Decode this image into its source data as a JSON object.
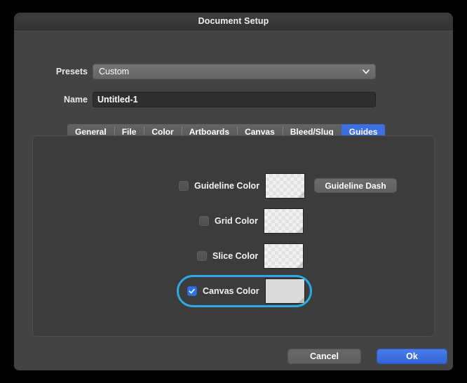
{
  "window": {
    "title": "Document Setup"
  },
  "form": {
    "presets": {
      "label": "Presets",
      "value": "Custom",
      "chevron_icon": "chevron-down-icon"
    },
    "name": {
      "label": "Name",
      "value": "Untitled-1",
      "placeholder": "Untitled-1"
    }
  },
  "tabs": [
    {
      "label": "General",
      "active": false
    },
    {
      "label": "File",
      "active": false
    },
    {
      "label": "Color",
      "active": false
    },
    {
      "label": "Artboards",
      "active": false
    },
    {
      "label": "Canvas",
      "active": false
    },
    {
      "label": "Bleed/Slug",
      "active": false
    },
    {
      "label": "Guides",
      "active": true
    }
  ],
  "guides_panel": {
    "rows": [
      {
        "label": "Guideline Color",
        "checked": false,
        "swatch": "transparent-checker"
      },
      {
        "label": "Grid Color",
        "checked": false,
        "swatch": "transparent-checker"
      },
      {
        "label": "Slice Color",
        "checked": false,
        "swatch": "transparent-checker"
      },
      {
        "label": "Canvas Color",
        "checked": true,
        "swatch": "solid-light-gray"
      }
    ],
    "guideline_dash_label": "Guideline Dash",
    "focused_row": "Canvas Color"
  },
  "footer": {
    "cancel_label": "Cancel",
    "ok_label": "Ok"
  },
  "colors": {
    "accent_blue": "#3e6fe0",
    "focus_ring": "#2aaae2",
    "checkbox_on": "#3071e8",
    "dialog_bg": "#434343",
    "panel_bg": "#3c3c3c",
    "canvas_swatch": "#d9d9d9"
  }
}
